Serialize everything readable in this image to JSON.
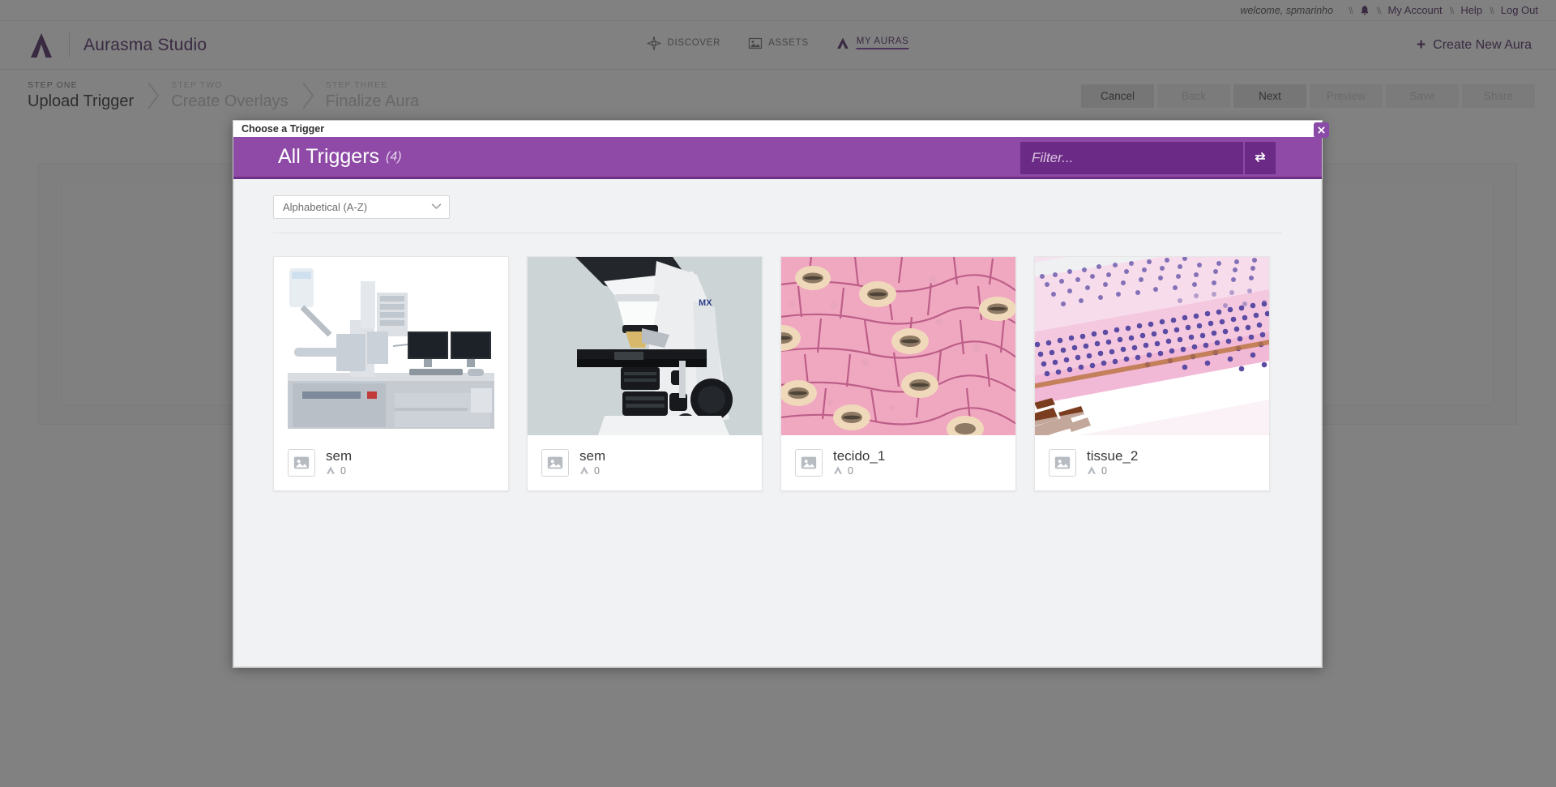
{
  "topbar": {
    "welcome": "welcome, spmarinho",
    "separator": "\\\\",
    "bell_icon": "bell-icon",
    "links": [
      {
        "label": "My Account",
        "name": "my-account-link"
      },
      {
        "label": "Help",
        "name": "help-link"
      },
      {
        "label": "Log Out",
        "name": "log-out-link"
      }
    ]
  },
  "header": {
    "brand": "Aurasma Studio",
    "logo_icon": "aurasma-logo-icon",
    "nav": [
      {
        "label": "DISCOVER",
        "icon": "compass-icon",
        "active": false
      },
      {
        "label": "ASSETS",
        "icon": "image-icon",
        "active": false
      },
      {
        "label": "MY AURAS",
        "icon": "aura-triangle-icon",
        "active": true
      }
    ],
    "create_new": "Create New Aura",
    "create_new_icon": "plus-icon"
  },
  "wizard": {
    "steps": [
      {
        "sup": "STEP ONE",
        "title": "Upload Trigger",
        "active": true
      },
      {
        "sup": "STEP TWO",
        "title": "Create Overlays",
        "active": false
      },
      {
        "sup": "STEP THREE",
        "title": "Finalize Aura",
        "active": false
      }
    ],
    "buttons": [
      {
        "label": "Cancel",
        "enabled": true
      },
      {
        "label": "Back",
        "enabled": false
      },
      {
        "label": "Next",
        "enabled": true
      },
      {
        "label": "Preview",
        "enabled": false
      },
      {
        "label": "Save",
        "enabled": false
      },
      {
        "label": "Share",
        "enabled": false
      }
    ]
  },
  "modal": {
    "window_title": "Choose a Trigger",
    "close_icon": "close-icon",
    "heading": "All Triggers",
    "count": "(4)",
    "filter_placeholder": "Filter...",
    "filter_value": "",
    "refresh_icon": "refresh-icon",
    "sort": {
      "selected": "Alphabetical (A-Z)",
      "chevron_icon": "chevron-down-icon"
    },
    "triggers": [
      {
        "name": "sem",
        "aura_count": "0",
        "thumb": "sem-microscope-photo",
        "meta_icon": "image-placeholder-icon",
        "aura_icon": "aura-triangle-icon"
      },
      {
        "name": "sem",
        "aura_count": "0",
        "thumb": "optical-microscope-photo",
        "meta_icon": "image-placeholder-icon",
        "aura_icon": "aura-triangle-icon"
      },
      {
        "name": "tecido_1",
        "aura_count": "0",
        "thumb": "plant-epidermis-photo",
        "meta_icon": "image-placeholder-icon",
        "aura_icon": "aura-triangle-icon"
      },
      {
        "name": "tissue_2",
        "aura_count": "0",
        "thumb": "retina-histology-photo",
        "meta_icon": "image-placeholder-icon",
        "aura_icon": "aura-triangle-icon"
      }
    ]
  },
  "colors": {
    "brand_purple": "#4b2660",
    "modal_purple": "#8e4aa6",
    "modal_purple_dark": "#6b2a85",
    "accent_underline": "#7b3f9d"
  }
}
